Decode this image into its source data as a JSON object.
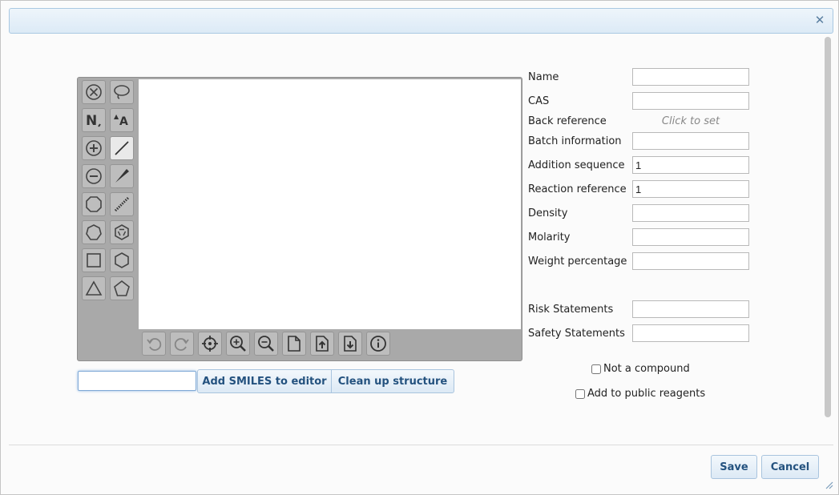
{
  "dialog": {
    "close_icon": "close-icon",
    "title": ""
  },
  "editor": {
    "left_tools": [
      {
        "name": "clear-icon"
      },
      {
        "name": "lasso-icon"
      },
      {
        "name": "atom-label-icon"
      },
      {
        "name": "text-icon"
      },
      {
        "name": "charge-plus-icon"
      },
      {
        "name": "single-bond-icon"
      },
      {
        "name": "charge-minus-icon"
      },
      {
        "name": "wedge-bond-icon"
      },
      {
        "name": "cyclooctane-icon"
      },
      {
        "name": "hash-bond-icon"
      },
      {
        "name": "cycloheptane-icon"
      },
      {
        "name": "benzene-icon"
      },
      {
        "name": "cyclobutane-icon"
      },
      {
        "name": "cyclohexane-icon"
      },
      {
        "name": "cyclopropane-icon"
      },
      {
        "name": "cyclopentane-icon"
      }
    ],
    "bottom_tools": [
      {
        "name": "undo-icon",
        "enabled": false
      },
      {
        "name": "redo-icon",
        "enabled": false
      },
      {
        "name": "center-icon",
        "enabled": true
      },
      {
        "name": "zoom-in-icon",
        "enabled": true
      },
      {
        "name": "zoom-out-icon",
        "enabled": true
      },
      {
        "name": "new-document-icon",
        "enabled": true
      },
      {
        "name": "open-file-icon",
        "enabled": true
      },
      {
        "name": "save-file-icon",
        "enabled": true
      },
      {
        "name": "info-icon",
        "enabled": true
      }
    ]
  },
  "smiles": {
    "input_value": "",
    "add_button": "Add SMILES to editor",
    "clean_button": "Clean up structure"
  },
  "form": {
    "name": {
      "label": "Name",
      "value": ""
    },
    "cas": {
      "label": "CAS",
      "value": ""
    },
    "back_reference": {
      "label": "Back reference",
      "placeholder": "Click to set"
    },
    "batch_information": {
      "label": "Batch information",
      "value": ""
    },
    "addition_sequence": {
      "label": "Addition sequence",
      "value": "1"
    },
    "reaction_reference": {
      "label": "Reaction reference",
      "value": "1"
    },
    "density": {
      "label": "Density",
      "value": ""
    },
    "molarity": {
      "label": "Molarity",
      "value": ""
    },
    "weight_percentage": {
      "label": "Weight percentage",
      "value": ""
    },
    "risk_statements": {
      "label": "Risk Statements",
      "value": ""
    },
    "safety_statements": {
      "label": "Safety Statements",
      "value": ""
    },
    "not_a_compound": {
      "label": "Not a compound",
      "checked": false
    },
    "add_to_public": {
      "label": "Add to public reagents",
      "checked": false
    }
  },
  "footer": {
    "save_label": "Save",
    "cancel_label": "Cancel"
  }
}
